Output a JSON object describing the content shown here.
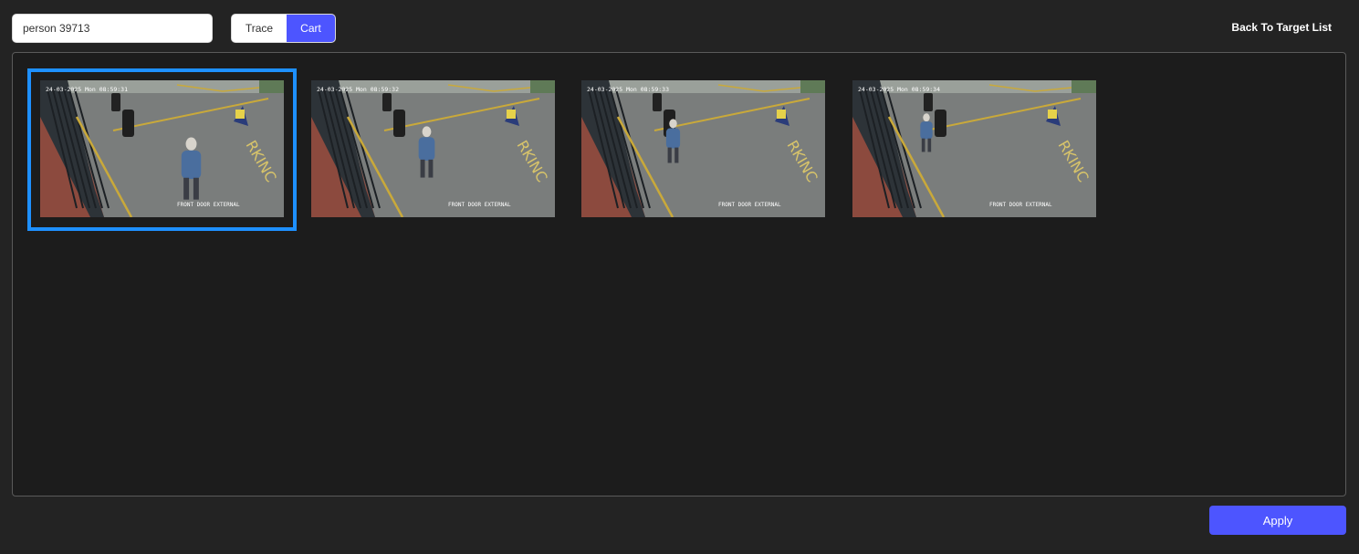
{
  "search": {
    "value": "person 39713"
  },
  "view_toggle": {
    "options": [
      {
        "label": "Trace",
        "active": false
      },
      {
        "label": "Cart",
        "active": true
      }
    ]
  },
  "back_link": {
    "label": "Back To Target List"
  },
  "thumbnails": [
    {
      "timestamp": "24-03-2025 Mon 08:59:31",
      "camera": "FRONT DOOR EXTERNAL",
      "selected": true,
      "person_pos": 0.85
    },
    {
      "timestamp": "24-03-2025 Mon 08:59:32",
      "camera": "FRONT DOOR EXTERNAL",
      "selected": false,
      "person_pos": 0.55
    },
    {
      "timestamp": "24-03-2025 Mon 08:59:33",
      "camera": "FRONT DOOR EXTERNAL",
      "selected": false,
      "person_pos": 0.35
    },
    {
      "timestamp": "24-03-2025 Mon 08:59:34",
      "camera": "FRONT DOOR EXTERNAL",
      "selected": false,
      "person_pos": 0.2
    }
  ],
  "footer": {
    "apply_label": "Apply"
  },
  "colors": {
    "accent": "#4d55ff",
    "selection": "#1e90ff"
  }
}
